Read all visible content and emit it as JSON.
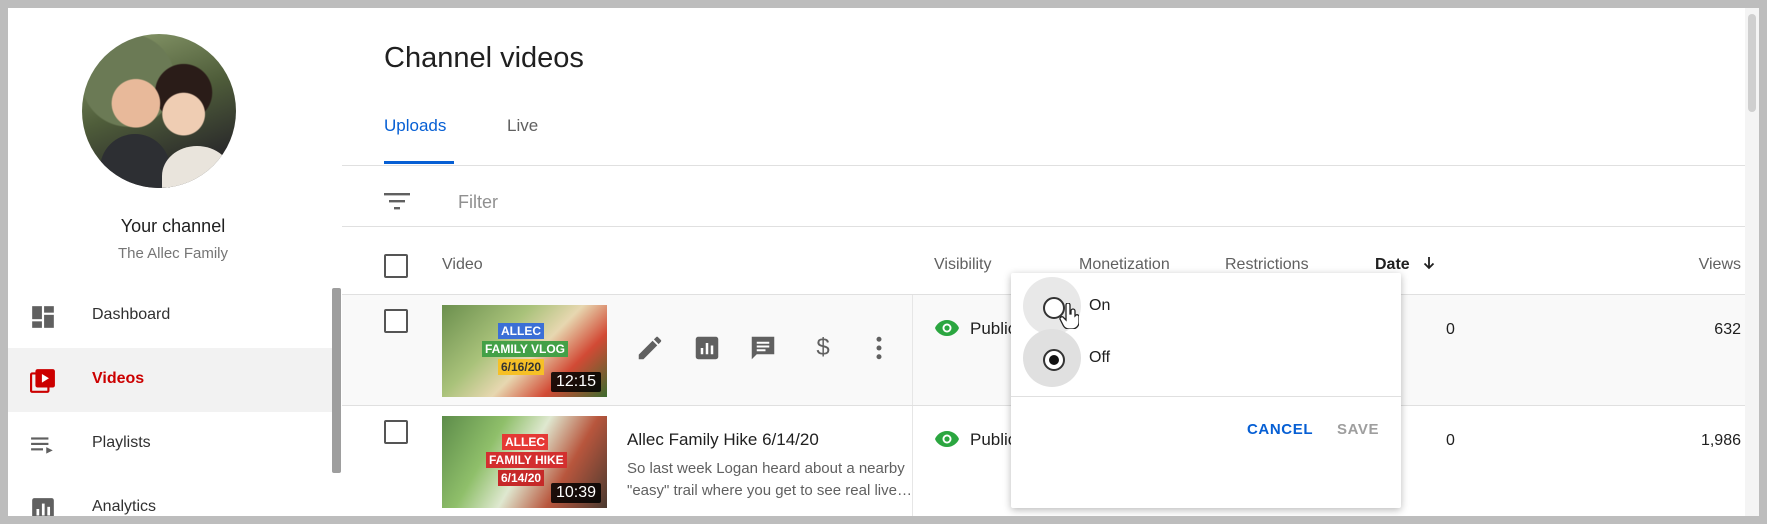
{
  "sidebar": {
    "channel_title": "Your channel",
    "channel_name": "The Allec Family",
    "items": [
      {
        "label": "Dashboard",
        "icon": "dashboard-icon",
        "active": false
      },
      {
        "label": "Videos",
        "icon": "videos-icon",
        "active": true
      },
      {
        "label": "Playlists",
        "icon": "playlists-icon",
        "active": false
      },
      {
        "label": "Analytics",
        "icon": "analytics-icon",
        "active": false
      }
    ]
  },
  "main": {
    "title": "Channel videos",
    "tabs": [
      {
        "label": "Uploads",
        "active": true
      },
      {
        "label": "Live",
        "active": false
      }
    ],
    "filter_placeholder": "Filter",
    "columns": {
      "video": "Video",
      "visibility": "Visibility",
      "monetization": "Monetization",
      "restrictions": "Restrictions",
      "date": "Date",
      "views": "Views"
    },
    "rows": [
      {
        "thumb_tags": [
          "ALLEC",
          "FAMILY VLOG",
          "6/16/20"
        ],
        "duration": "12:15",
        "title": "",
        "description": "",
        "visibility": "Public",
        "date_fragment": "0",
        "views": "632",
        "actions": [
          "edit-icon",
          "analytics-icon",
          "comments-icon",
          "monetization-icon",
          "more-icon"
        ]
      },
      {
        "thumb_tags": [
          "ALLEC",
          "FAMILY HIKE",
          "6/14/20"
        ],
        "duration": "10:39",
        "title": "Allec Family Hike 6/14/20",
        "description": "So last week Logan heard about a nearby \"easy\" trail where you get to see real live…",
        "visibility": "Public",
        "date_fragment": "0",
        "views": "1,986"
      }
    ]
  },
  "popup": {
    "options": [
      {
        "label": "On",
        "checked": false
      },
      {
        "label": "Off",
        "checked": true
      }
    ],
    "cancel_label": "CANCEL",
    "save_label": "SAVE"
  },
  "colors": {
    "accent_blue": "#065fd4",
    "active_red": "#cc0000",
    "public_green": "#2ba640"
  }
}
